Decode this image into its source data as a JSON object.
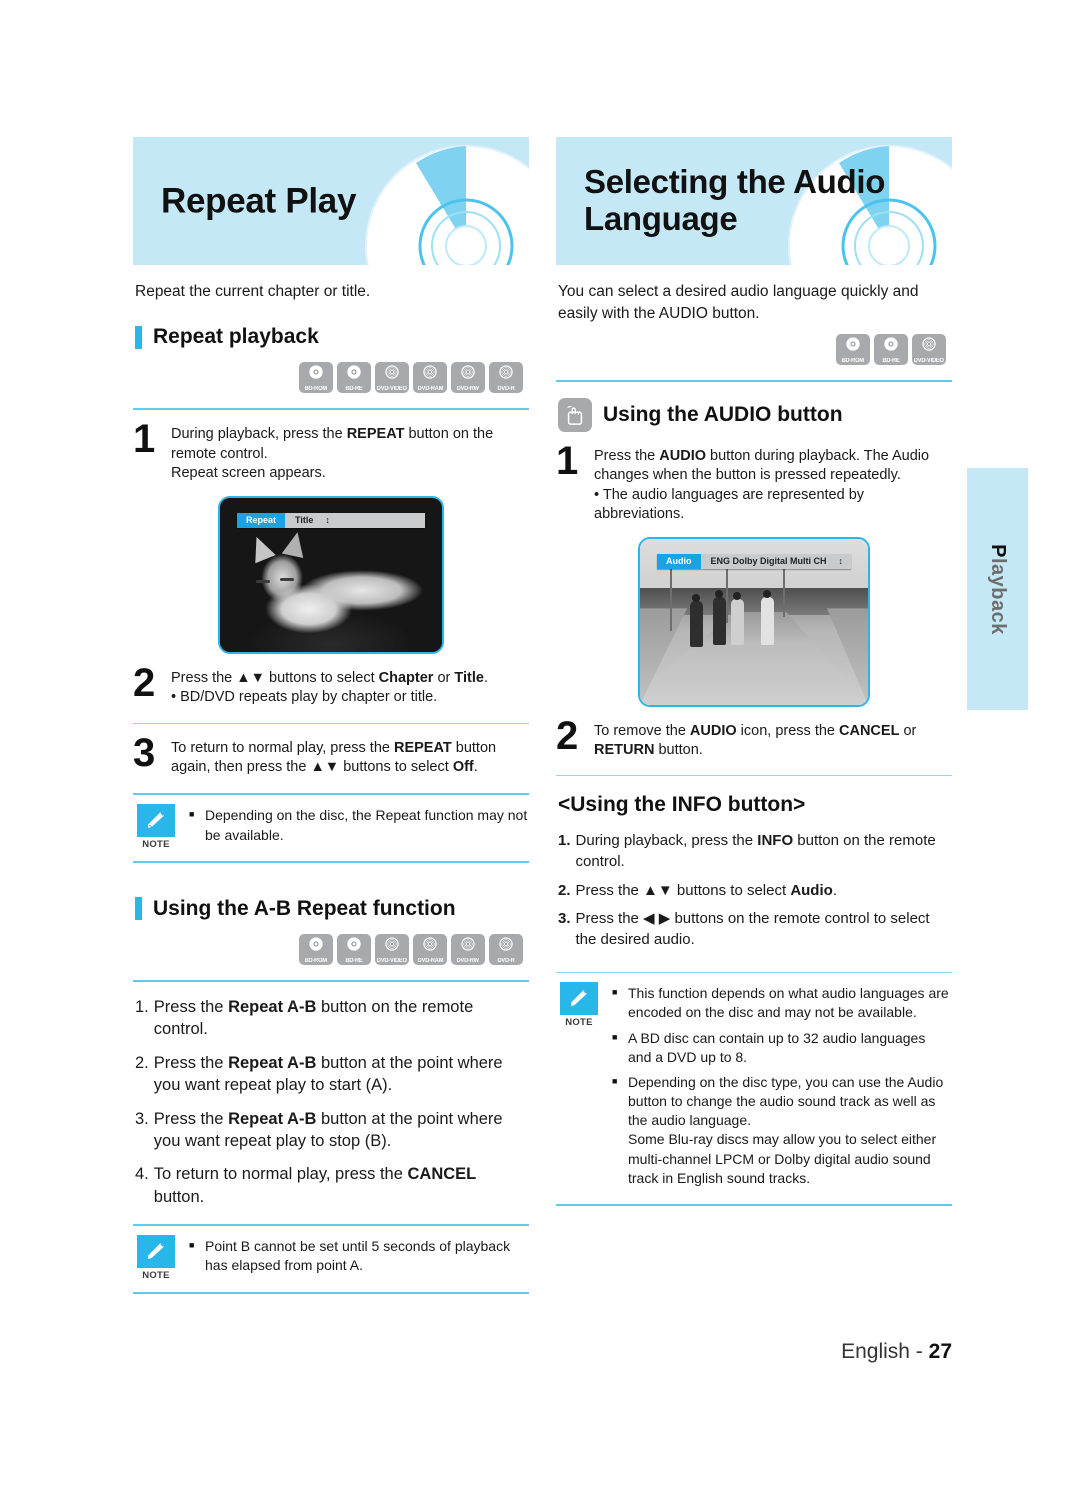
{
  "page": {
    "footer_label": "English - ",
    "footer_number": "27",
    "side_tab": "Playback"
  },
  "left_column": {
    "banner_title": "Repeat Play",
    "intro": "Repeat the current chapter or title.",
    "section_heading": "Repeat playback",
    "disc_badges": [
      "BD-ROM",
      "BD-RE",
      "DVD-VIDEO",
      "DVD-RAM",
      "DVD-RW",
      "DVD-R"
    ],
    "steps": [
      {
        "number": "1",
        "text_parts": [
          {
            "t": "During playback, press the ",
            "b": false
          },
          {
            "t": "REPEAT",
            "b": true
          },
          {
            "t": " button on the remote control.\nRepeat screen appears.",
            "b": false
          }
        ]
      },
      {
        "number": "2",
        "text_parts": [
          {
            "t": "Press the ▲▼ buttons to select ",
            "b": false
          },
          {
            "t": "Chapter",
            "b": true
          },
          {
            "t": " or ",
            "b": false
          },
          {
            "t": "Title",
            "b": true
          },
          {
            "t": ".\n• BD/DVD repeats play by chapter or title.",
            "b": false
          }
        ]
      },
      {
        "number": "3",
        "text_parts": [
          {
            "t": "To return to normal play, press the ",
            "b": false
          },
          {
            "t": "REPEAT",
            "b": true
          },
          {
            "t": " button again, then press the ▲▼ buttons to select ",
            "b": false
          },
          {
            "t": "Off",
            "b": true
          },
          {
            "t": ".",
            "b": false
          }
        ]
      }
    ],
    "screenshot": {
      "osd_key": "Repeat",
      "osd_value": "Title",
      "osd_arrows": "↕",
      "alt": "sleeping cat on dark sofa"
    },
    "note_1": {
      "caption": "NOTE",
      "items": [
        "Depending on the disc, the Repeat function may not be available."
      ]
    },
    "ab_heading": "Using the A-B Repeat function",
    "ab_badges": [
      "BD-ROM",
      "BD-RE",
      "DVD-VIDEO",
      "DVD-RAM",
      "DVD-RW",
      "DVD-R"
    ],
    "ab_list": [
      {
        "marker": "1.",
        "parts": [
          {
            "t": "Press the ",
            "b": false
          },
          {
            "t": "Repeat A-B",
            "b": true
          },
          {
            "t": " button on the remote control.",
            "b": false
          }
        ]
      },
      {
        "marker": "2.",
        "parts": [
          {
            "t": "Press the ",
            "b": false
          },
          {
            "t": "Repeat A-B",
            "b": true
          },
          {
            "t": " button at the point where you want repeat play to start (A).",
            "b": false
          }
        ]
      },
      {
        "marker": "3.",
        "parts": [
          {
            "t": "Press the ",
            "b": false
          },
          {
            "t": "Repeat A-B",
            "b": true
          },
          {
            "t": " button at the point where you want repeat play to stop (B).",
            "b": false
          }
        ]
      },
      {
        "marker": "4.",
        "parts": [
          {
            "t": "To return to normal play, press the ",
            "b": false
          },
          {
            "t": "CANCEL",
            "b": true
          },
          {
            "t": " button.",
            "b": false
          }
        ]
      }
    ],
    "note_2": {
      "caption": "NOTE",
      "items": [
        "Point B cannot be set until 5 seconds of playback has elapsed from point A."
      ]
    }
  },
  "right_column": {
    "banner_title": "Selecting the Audio\nLanguage",
    "intro": "You can select a desired audio language quickly and easily with the AUDIO button.",
    "disc_badges": [
      "BD-ROM",
      "BD-RE",
      "DVD-VIDEO"
    ],
    "audio_heading": "Using the AUDIO button",
    "audio_icon": "press-button-icon",
    "steps": [
      {
        "number": "1",
        "text_parts": [
          {
            "t": "Press the ",
            "b": false
          },
          {
            "t": "AUDIO",
            "b": true
          },
          {
            "t": " button during playback. The Audio changes when the button is pressed repeatedly.\n• The audio languages are represented by\n   abbreviations.",
            "b": false
          }
        ]
      },
      {
        "number": "2",
        "text_parts": [
          {
            "t": "To remove the ",
            "b": false
          },
          {
            "t": "AUDIO",
            "b": true
          },
          {
            "t": " icon, press the ",
            "b": false
          },
          {
            "t": "CANCEL",
            "b": true
          },
          {
            "t": " or ",
            "b": false
          },
          {
            "t": "RETURN",
            "b": true
          },
          {
            "t": " button.",
            "b": false
          }
        ]
      }
    ],
    "screenshot": {
      "osd_key": "Audio",
      "osd_value": "ENG Dolby Digital Multi CH",
      "osd_arrows": "↕",
      "alt": "four people walking along a road"
    },
    "info_heading": "<Using the INFO button>",
    "info_list": [
      {
        "marker": "1.",
        "parts": [
          {
            "t": "During playback, press the ",
            "b": false
          },
          {
            "t": "INFO",
            "b": true
          },
          {
            "t": " button on the remote control.",
            "b": false
          }
        ]
      },
      {
        "marker": "2.",
        "parts": [
          {
            "t": "Press the  ▲▼ buttons to select ",
            "b": false
          },
          {
            "t": "Audio",
            "b": true
          },
          {
            "t": ".",
            "b": false
          }
        ]
      },
      {
        "marker": "3.",
        "parts": [
          {
            "t": "Press the ◀ ▶ buttons on the remote control to select the desired audio.",
            "b": false
          }
        ]
      }
    ],
    "note": {
      "caption": "NOTE",
      "items": [
        "This function depends on what audio languages are encoded on the disc and may not be available.",
        "A BD disc can contain up to 32 audio languages and a DVD up to 8.",
        "Depending on the disc type, you can use the Audio button to change the audio sound track as well as the audio language.\nSome Blu-ray discs may allow you to select either multi-channel LPCM or Dolby digital audio sound track in English sound tracks."
      ]
    }
  }
}
